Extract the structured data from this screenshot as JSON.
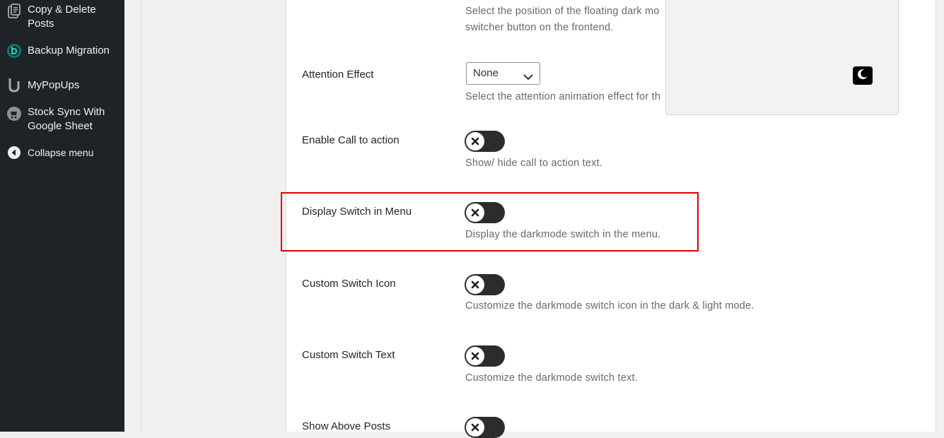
{
  "sidebar": {
    "items": [
      {
        "label": "Copy & Delete Posts",
        "icon": "copy-delete-icon"
      },
      {
        "label": "Backup Migration",
        "icon": "backup-migration-icon"
      },
      {
        "label": "MyPopUps",
        "icon": "mypopups-icon"
      },
      {
        "label": "Stock Sync With Google Sheet",
        "icon": "stock-sync-icon"
      }
    ],
    "collapse": {
      "label": "Collapse menu",
      "icon": "collapse-arrow-icon"
    }
  },
  "settings": {
    "position": {
      "description": "Select the position of the floating dark mo switcher button on the frontend."
    },
    "attention_effect": {
      "label": "Attention Effect",
      "value": "None",
      "description": "Select the attention animation effect for th"
    },
    "enable_cta": {
      "label": "Enable Call to action",
      "enabled": false,
      "description": "Show/ hide call to action text."
    },
    "display_switch_menu": {
      "label": "Display Switch in Menu",
      "enabled": false,
      "description": "Display the darkmode switch in the menu."
    },
    "custom_switch_icon": {
      "label": "Custom Switch Icon",
      "enabled": false,
      "description": "Customize the darkmode switch icon in the dark & light mode."
    },
    "custom_switch_text": {
      "label": "Custom Switch Text",
      "enabled": false,
      "description": "Customize the darkmode switch text."
    },
    "show_above_posts": {
      "label": "Show Above Posts",
      "enabled": false
    }
  },
  "preview": {
    "icon": "moon-icon"
  },
  "colors": {
    "sidebar_bg": "#1d2327",
    "toggle_off": "#2c2c2c",
    "highlight": "#e00000"
  }
}
